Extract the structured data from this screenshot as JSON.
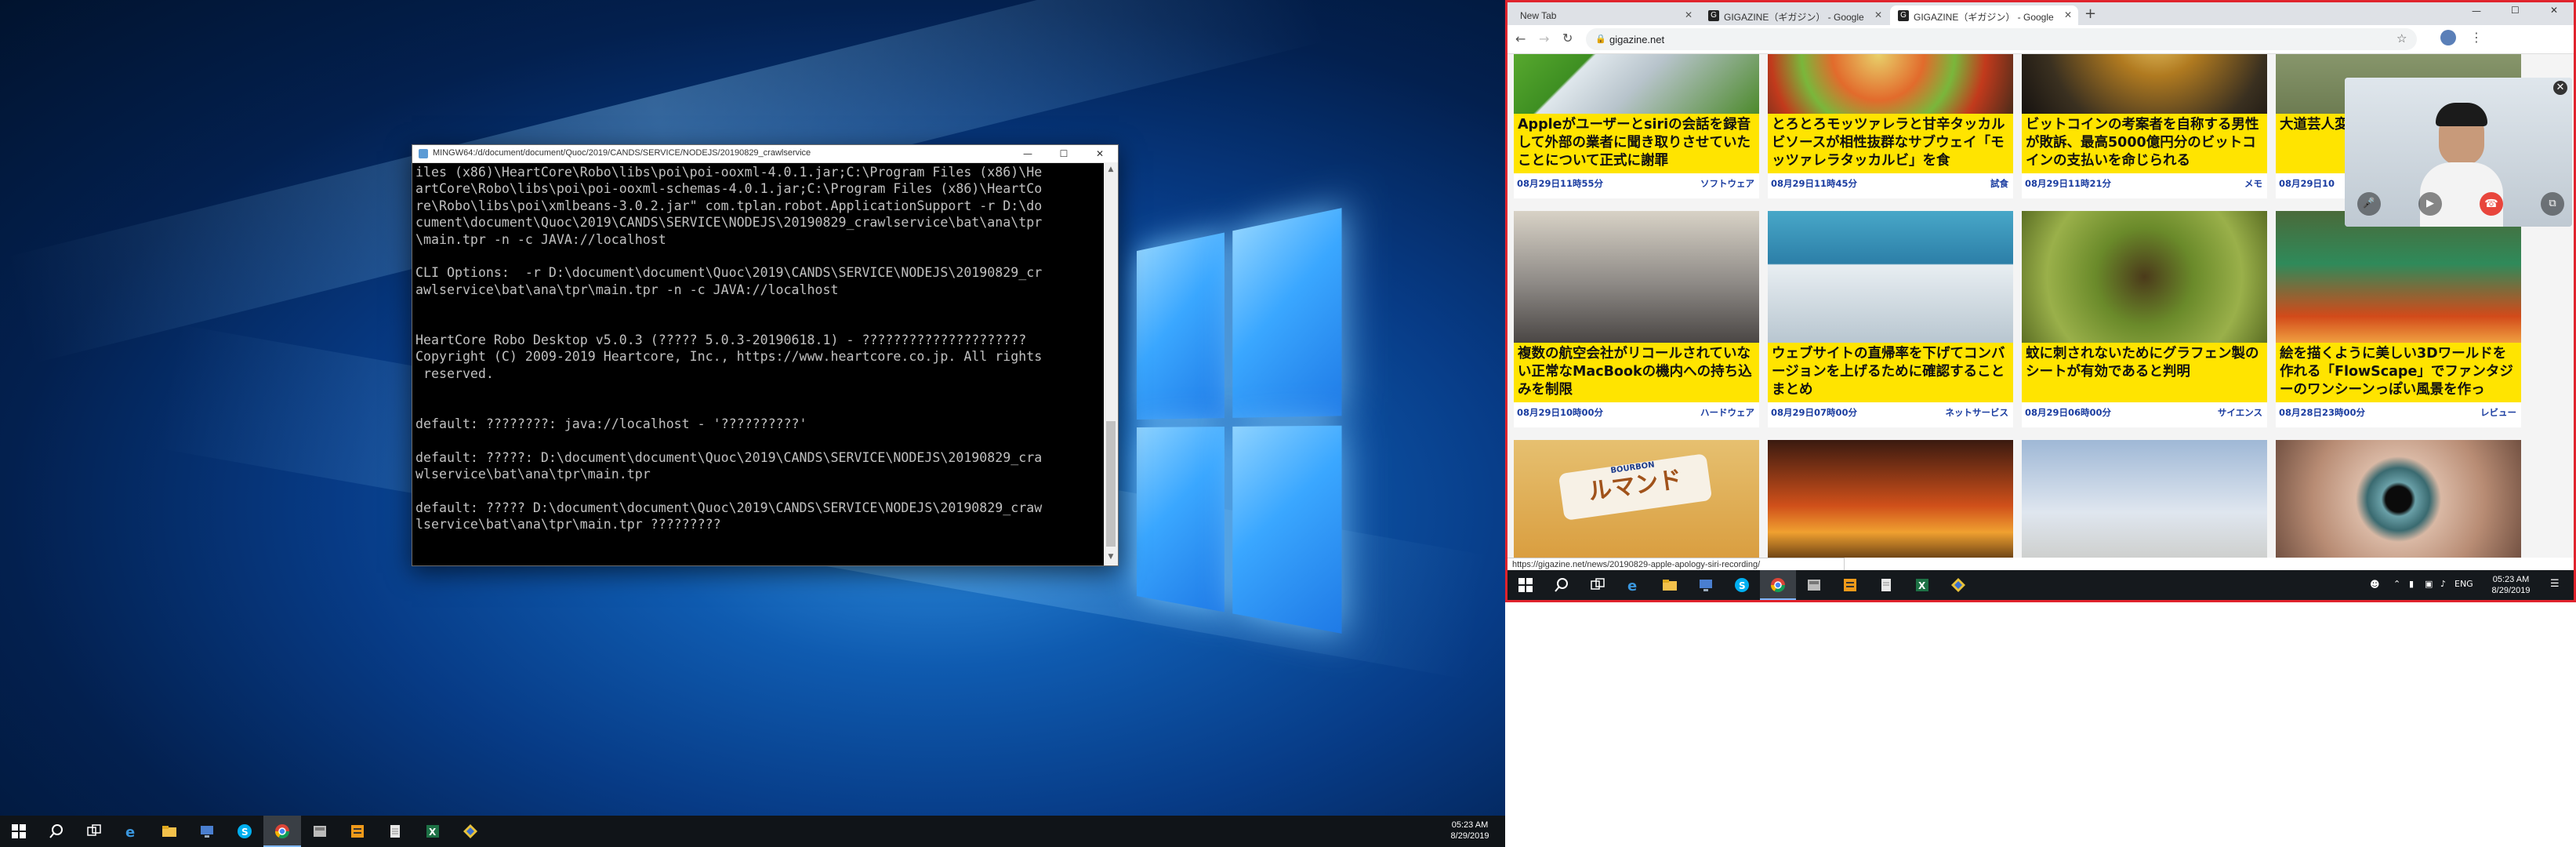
{
  "terminal": {
    "title": "MINGW64:/d/document/document/Quoc/2019/CANDS/SERVICE/NODEJS/20190829_crawlservice",
    "lines": [
      "iles (x86)\\HeartCore\\Robo\\libs\\poi\\poi-ooxml-4.0.1.jar;C:\\Program Files (x86)\\He",
      "artCore\\Robo\\libs\\poi\\poi-ooxml-schemas-4.0.1.jar;C:\\Program Files (x86)\\HeartCo",
      "re\\Robo\\libs\\poi\\xmlbeans-3.0.2.jar\" com.tplan.robot.ApplicationSupport -r D:\\do",
      "cument\\document\\Quoc\\2019\\CANDS\\SERVICE\\NODEJS\\20190829_crawlservice\\bat\\ana\\tpr",
      "\\main.tpr -n -c JAVA://localhost",
      "",
      "CLI Options:  -r D:\\document\\document\\Quoc\\2019\\CANDS\\SERVICE\\NODEJS\\20190829_cr",
      "awlservice\\bat\\ana\\tpr\\main.tpr -n -c JAVA://localhost",
      "",
      "",
      "HeartCore Robo Desktop v5.0.3 (????? 5.0.3-20190618.1) - ?????????????????????",
      "Copyright (C) 2009-2019 Heartcore, Inc., https://www.heartcore.co.jp. All rights",
      " reserved.",
      "",
      "",
      "default: ????????: java://localhost - '??????????'",
      "",
      "default: ?????: D:\\document\\document\\Quoc\\2019\\CANDS\\SERVICE\\NODEJS\\20190829_cra",
      "wlservice\\bat\\ana\\tpr\\main.tpr",
      "",
      "default: ????? D:\\document\\document\\Quoc\\2019\\CANDS\\SERVICE\\NODEJS\\20190829_craw",
      "lservice\\bat\\ana\\tpr\\main.tpr ?????????"
    ]
  },
  "taskbar_left": {
    "clock_time": "05:23 AM",
    "clock_date": "8/29/2019",
    "icons": [
      "windows-start-icon",
      "search-icon",
      "task-view-icon",
      "edge-icon",
      "file-explorer-icon",
      "remote-desktop-icon",
      "skype-icon",
      "chrome-icon",
      "app-icon",
      "sublime-icon",
      "notepad-icon",
      "excel-icon",
      "app-diamond-icon"
    ]
  },
  "browser": {
    "tabs": [
      {
        "label": "New Tab",
        "active": false
      },
      {
        "label": "GIGAZINE（ギガジン） - Google",
        "active": false
      },
      {
        "label": "GIGAZINE（ギガジン） - Google",
        "active": true
      }
    ],
    "new_tab_label": "+",
    "url": "gigazine.net",
    "status_url": "https://gigazine.net/news/20190829-apple-apology-siri-recording/",
    "articles": [
      {
        "title": "Appleがユーザーとsiriの会話を録音して外部の業者に聞き取りさせていたことについて正式に謝罪",
        "date": "08月29日11時55分",
        "category": "ソフトウェア",
        "img": "phone"
      },
      {
        "title": "とろとろモッツァレラと甘辛タッカルビソースが相性抜群なサブウェイ「モッツァレラタッカルビ」を食",
        "date": "08月29日11時45分",
        "category": "試食",
        "img": "food"
      },
      {
        "title": "ビットコインの考案者を自称する男性が敗訴、最高5000億円分のビットコインの支払いを命じられる",
        "date": "08月29日11時21分",
        "category": "メモ",
        "img": "coin"
      },
      {
        "title": "大道芸人変貌して終予告編",
        "date": "08月29日10",
        "category": "",
        "img": "street"
      },
      {
        "title": "複数の航空会社がリコールされていない正常なMacBookの機内への持ち込みを制限",
        "date": "08月29日10時00分",
        "category": "ハードウェア",
        "img": "laptop"
      },
      {
        "title": "ウェブサイトの直帰率を下げてコンバージョンを上げるために確認することまとめ",
        "date": "08月29日07時00分",
        "category": "ネットサービス",
        "img": "analytics"
      },
      {
        "title": "蚊に刺されないためにグラフェン製のシートが有効であると判明",
        "date": "08月29日06時00分",
        "category": "サイエンス",
        "img": "mosquito"
      },
      {
        "title": "絵を描くように美しい3Dワールドを作れる「FlowScape」でファンタジーのワンシーンっぽい風景を作っ",
        "date": "08月28日23時00分",
        "category": "レビュー",
        "img": "fantasy"
      },
      {
        "title": "",
        "date": "",
        "category": "",
        "img": "snack"
      },
      {
        "title": "",
        "date": "",
        "category": "",
        "img": "fire"
      },
      {
        "title": "",
        "date": "",
        "category": "",
        "img": "building"
      },
      {
        "title": "",
        "date": "",
        "category": "",
        "img": "eye"
      }
    ],
    "snack_text": "ルマンド",
    "snack_brand": "BOURBON"
  },
  "taskbar_right": {
    "clock_time": "05:23 AM",
    "clock_date": "8/29/2019",
    "lang": "ENG"
  },
  "colors": {
    "title_bg": "#ffe400",
    "meta_text": "#1a3ca0",
    "monitor_border": "#e0232d"
  }
}
